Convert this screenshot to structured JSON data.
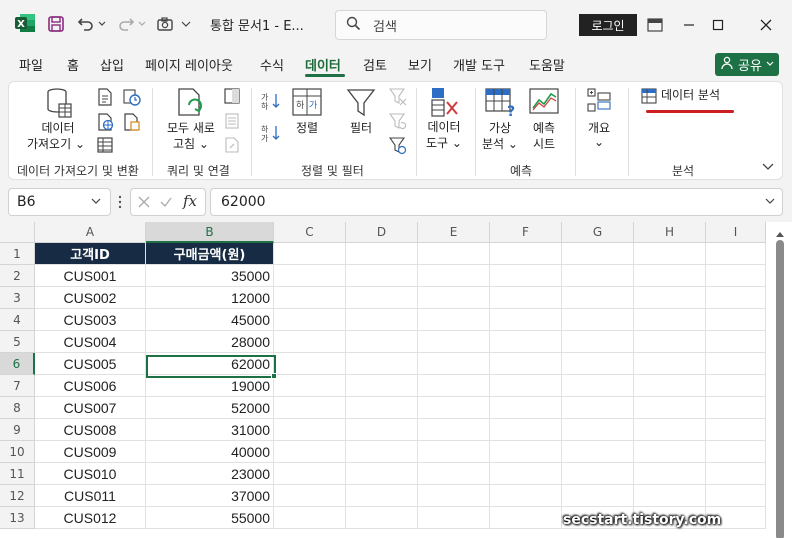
{
  "app": {
    "name": "Excel",
    "doc_title": "통합 문서1  -  E...",
    "search_placeholder": "검색",
    "login_label": "로그인"
  },
  "menu": {
    "tabs": [
      "파일",
      "홈",
      "삽입",
      "페이지 레이아웃",
      "수식",
      "데이터",
      "검토",
      "보기",
      "개발 도구",
      "도움말"
    ],
    "active_tab": "데이터",
    "share_label": "공유"
  },
  "ribbon": {
    "get_data": {
      "label_line1": "데이터",
      "label_line2": "가져오기"
    },
    "refresh_all": {
      "label_line1": "모두 새로",
      "label_line2": "고침"
    },
    "sort": {
      "label": "정렬"
    },
    "filter": {
      "label": "필터"
    },
    "data_tools": {
      "label_line1": "데이터",
      "label_line2": "도구"
    },
    "what_if": {
      "label_line1": "가상",
      "label_line2": "분석"
    },
    "forecast": {
      "label_line1": "예측",
      "label_line2": "시트"
    },
    "outline": {
      "label": "개요"
    },
    "data_analysis": {
      "label": "데이터 분석"
    },
    "groups": {
      "get_transform": "데이터 가져오기 및 변환",
      "queries": "쿼리 및 연결",
      "sort_filter": "정렬 및 필터",
      "forecast": "예측",
      "analysis": "분석"
    }
  },
  "formula_bar": {
    "name_box": "B6",
    "fx": "fx",
    "value": "62000"
  },
  "sheet": {
    "columns": [
      "A",
      "B",
      "C",
      "D",
      "E",
      "F",
      "G",
      "H",
      "I"
    ],
    "row_numbers": [
      "1",
      "2",
      "3",
      "4",
      "5",
      "6",
      "7",
      "8",
      "9",
      "10",
      "11",
      "12",
      "13"
    ],
    "header": [
      "고객ID",
      "구매금액(원)"
    ],
    "rows": [
      [
        "CUS001",
        "35000"
      ],
      [
        "CUS002",
        "12000"
      ],
      [
        "CUS003",
        "45000"
      ],
      [
        "CUS004",
        "28000"
      ],
      [
        "CUS005",
        "62000"
      ],
      [
        "CUS006",
        "19000"
      ],
      [
        "CUS007",
        "52000"
      ],
      [
        "CUS008",
        "31000"
      ],
      [
        "CUS009",
        "40000"
      ],
      [
        "CUS010",
        "23000"
      ],
      [
        "CUS011",
        "37000"
      ],
      [
        "CUS012",
        "55000"
      ]
    ],
    "selected_cell": "B6"
  },
  "watermark": "secstart.tistory.com",
  "colors": {
    "accent": "#1e7145",
    "header_fill": "#172c44",
    "underline": "#cc1f1f"
  }
}
